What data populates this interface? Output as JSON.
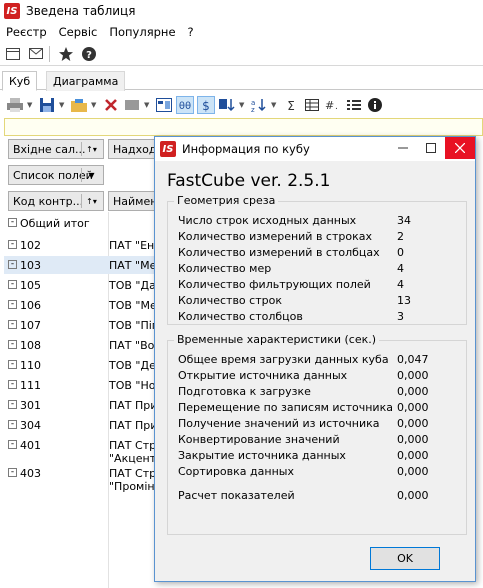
{
  "window": {
    "logo": "IS",
    "title": "Зведена таблиця"
  },
  "menu": [
    "Реєстр",
    "Сервіс",
    "Популярне",
    "?"
  ],
  "tabs": [
    "Куб",
    "Диаграмма"
  ],
  "fields": {
    "incoming_balance": "Вхідне сал...",
    "arrival": "Надходж",
    "field_list": "Список полей",
    "contractor_code": "Код контр...",
    "name": "Наймену"
  },
  "grid": {
    "total_label": "Общий итог",
    "rows": [
      {
        "code": "102",
        "name": "ПАТ \"Ене"
      },
      {
        "code": "103",
        "name": "ПАТ \"Мед"
      },
      {
        "code": "105",
        "name": "ТОВ \"Дан"
      },
      {
        "code": "106",
        "name": "ТОВ \"Мед"
      },
      {
        "code": "107",
        "name": "ТОВ \"Пігу"
      },
      {
        "code": "108",
        "name": "ПАТ \"Вод"
      },
      {
        "code": "110",
        "name": "ТОВ \"Ден"
      },
      {
        "code": "111",
        "name": "ТОВ \"Нос"
      },
      {
        "code": "301",
        "name": "ПАТ Прик"
      },
      {
        "code": "304",
        "name": "ПАТ Прик"
      },
      {
        "code": "401",
        "name": "ПАТ Стра\n\"Акцент\""
      },
      {
        "code": "403",
        "name": "ПАТ Стра\n\"Промінь"
      }
    ]
  },
  "dialog": {
    "logo": "IS",
    "title": "Информация по кубу",
    "heading": "FastCube ver. 2.5.1",
    "slice_group": {
      "label": "Геометрия среза",
      "rows": [
        {
          "key": "Число строк исходных данных",
          "value": "34"
        },
        {
          "key": "Количество измерений в строках",
          "value": "2"
        },
        {
          "key": "Количество измерений в столбцах",
          "value": "0"
        },
        {
          "key": "Количество мер",
          "value": "4"
        },
        {
          "key": "Количество фильтрующих полей",
          "value": "4"
        },
        {
          "key": "Количество строк",
          "value": "13"
        },
        {
          "key": "Количество столбцов",
          "value": "3"
        }
      ]
    },
    "time_group": {
      "label": "Временные характеристики (сек.)",
      "rows": [
        {
          "key": "Общее время загрузки данных куба",
          "value": "0,047"
        },
        {
          "key": "Открытие источника данных",
          "value": "0,000"
        },
        {
          "key": "Подготовка к загрузке",
          "value": "0,000"
        },
        {
          "key": "Перемещение по записям источника",
          "value": "0,000"
        },
        {
          "key": "Получение значений из источника",
          "value": "0,000"
        },
        {
          "key": "Конвертирование значений",
          "value": "0,000"
        },
        {
          "key": "Закрытие источника данных",
          "value": "0,000"
        },
        {
          "key": "Сортировка данных",
          "value": "0,000"
        },
        {
          "key": "Расчет показателей",
          "value": "0,000"
        }
      ]
    },
    "ok_label": "OK"
  }
}
